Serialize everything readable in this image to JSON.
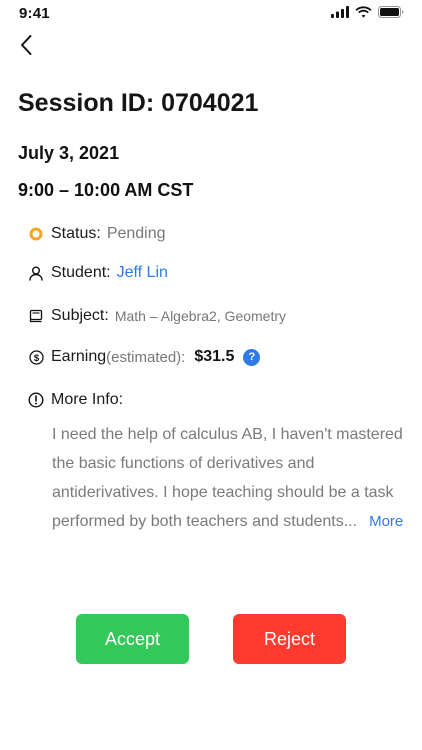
{
  "status_bar": {
    "time": "9:41",
    "icons": [
      "cellular-signal-icon",
      "wifi-icon",
      "battery-icon"
    ]
  },
  "header": {
    "back_icon": "chevron-left-icon",
    "title": "Session ID: 0704021"
  },
  "session": {
    "date": "July 3, 2021",
    "time": "9:00 – 10:00 AM CST",
    "status": {
      "icon": "status-ring-icon",
      "label": "Status:",
      "value": "Pending",
      "color": "#f5a623"
    },
    "student": {
      "icon": "user-icon",
      "label": "Student:",
      "value": "Jeff Lin"
    },
    "subject": {
      "icon": "book-icon",
      "label": "Subject:",
      "value": "Math – Algebra2, Geometry"
    },
    "earning": {
      "icon": "dollar-circle-icon",
      "label": "Earning",
      "estimated": "(estimated):",
      "amount": "$31.5",
      "help_icon": "question-icon",
      "help_glyph": "?"
    },
    "more_info": {
      "icon": "exclamation-circle-icon",
      "label": "More Info:",
      "lines": [
        "I need the help of calculus AB, I haven't mastered",
        "the basic functions of derivatives and",
        "antiderivatives. I hope teaching should be a task",
        "performed by both teachers and students..."
      ],
      "more_label": "More"
    }
  },
  "actions": {
    "accept_label": "Accept",
    "reject_label": "Reject"
  },
  "colors": {
    "accept": "#34c759",
    "reject": "#ff3b30",
    "link": "#2f7be5",
    "pending": "#f5a623"
  }
}
